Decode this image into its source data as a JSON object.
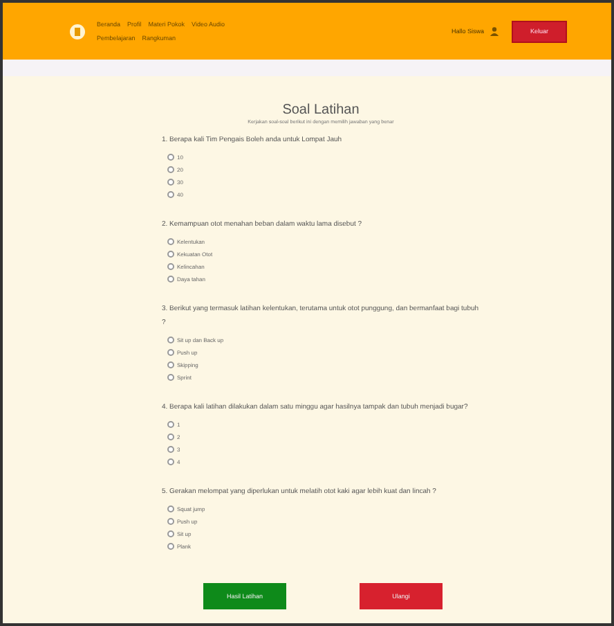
{
  "header": {
    "nav": [
      {
        "label": "Beranda"
      },
      {
        "label": "Profil"
      },
      {
        "label": "Materi Pokok"
      },
      {
        "label": "Video Audio"
      },
      {
        "label": "Pembelajaran"
      },
      {
        "label": "Rangkuman"
      }
    ],
    "user": "Hallo Siswa",
    "logout": "Keluar"
  },
  "title": "Soal Latihan",
  "subtitle": "Kerjakan soal-soal berikut ini dengan memilih jawaban yang benar",
  "questions": [
    {
      "text": "1. Berapa kali Tim Pengais Boleh anda untuk Lompat Jauh",
      "options": [
        {
          "label": "10",
          "selected": false
        },
        {
          "label": "20",
          "selected": false
        },
        {
          "label": "30",
          "selected": false
        },
        {
          "label": "40",
          "selected": false
        }
      ]
    },
    {
      "text": "2. Kemampuan otot menahan beban dalam waktu lama disebut ?",
      "options": [
        {
          "label": "Kelentukan",
          "selected": false
        },
        {
          "label": "Kekuatan Otot",
          "selected": false
        },
        {
          "label": "Kelincahan",
          "selected": false
        },
        {
          "label": "Daya tahan",
          "selected": false
        }
      ]
    },
    {
      "text": "3. Berikut yang termasuk latihan kelentukan, terutama untuk otot punggung, dan bermanfaat bagi tubuh ?",
      "options": [
        {
          "label": "Sit up dan Back up",
          "selected": false
        },
        {
          "label": "Push up",
          "selected": false
        },
        {
          "label": "Skipping",
          "selected": false
        },
        {
          "label": "Sprint",
          "selected": false
        }
      ]
    },
    {
      "text": "4. Berapa kali latihan dilakukan dalam satu minggu agar hasilnya tampak dan tubuh menjadi bugar?",
      "options": [
        {
          "label": "1",
          "selected": false
        },
        {
          "label": "2",
          "selected": false
        },
        {
          "label": "3",
          "selected": false
        },
        {
          "label": "4",
          "selected": false
        }
      ]
    },
    {
      "text": "5. Gerakan melompat yang diperlukan untuk melatih otot kaki agar lebih kuat dan lincah ?",
      "options": [
        {
          "label": "Squat jump",
          "selected": false
        },
        {
          "label": "Push up",
          "selected": false
        },
        {
          "label": "Sit up",
          "selected": false
        },
        {
          "label": "Plank",
          "selected": false
        }
      ]
    }
  ],
  "buttons": [
    {
      "label": "Hasil Latihan",
      "kind": "submit"
    },
    {
      "label": "Ulangi",
      "kind": "reset"
    }
  ]
}
